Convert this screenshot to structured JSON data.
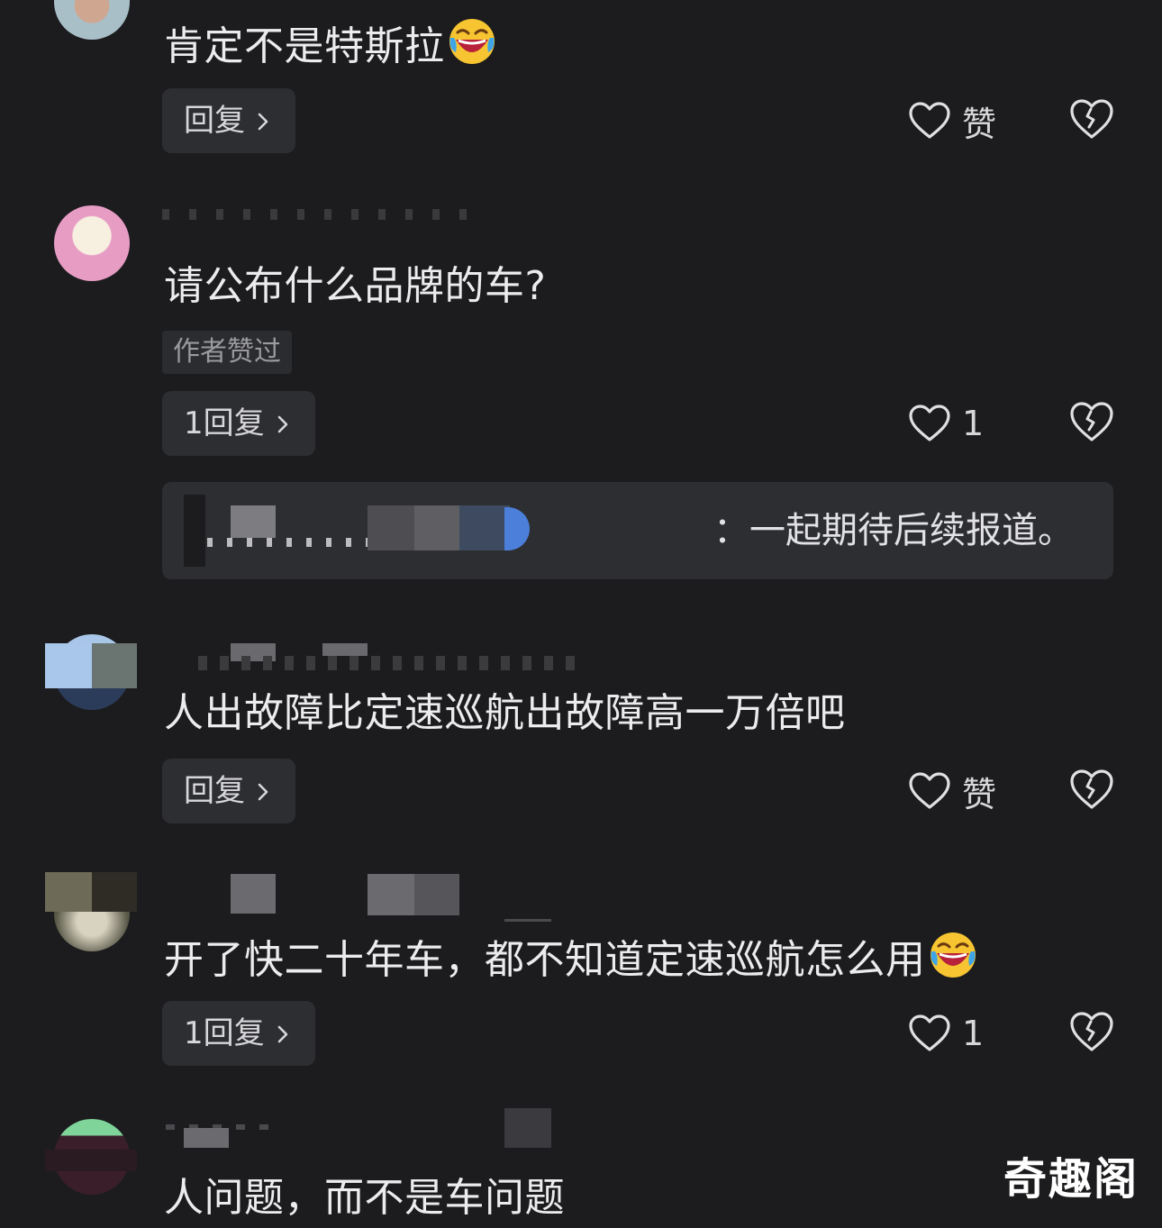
{
  "comments": [
    {
      "text": "肯定不是特斯拉",
      "emoji": "laughing-crying-emoji",
      "reply_label": "回复",
      "like_label": "赞"
    },
    {
      "text": "请公布什么品牌的车?",
      "author_tag": "作者赞过",
      "reply_label": "1回复",
      "like_label": "1",
      "sub_reply": {
        "text": "：一起期待后续报道。"
      }
    },
    {
      "text": "人出故障比定速巡航出故障高一万倍吧",
      "reply_label": "回复",
      "like_label": "赞"
    },
    {
      "text": "开了快二十年车，都不知道定速巡航怎么用",
      "emoji": "laughing-crying-emoji",
      "reply_label": "1回复",
      "like_label": "1"
    },
    {
      "text": "人问题，而不是车问题"
    }
  ],
  "watermark": "奇趣阁",
  "colors": {
    "background": "#1c1c1e",
    "button_bg": "#2d2e31",
    "text": "#ececee",
    "muted": "#9a9a9f"
  }
}
